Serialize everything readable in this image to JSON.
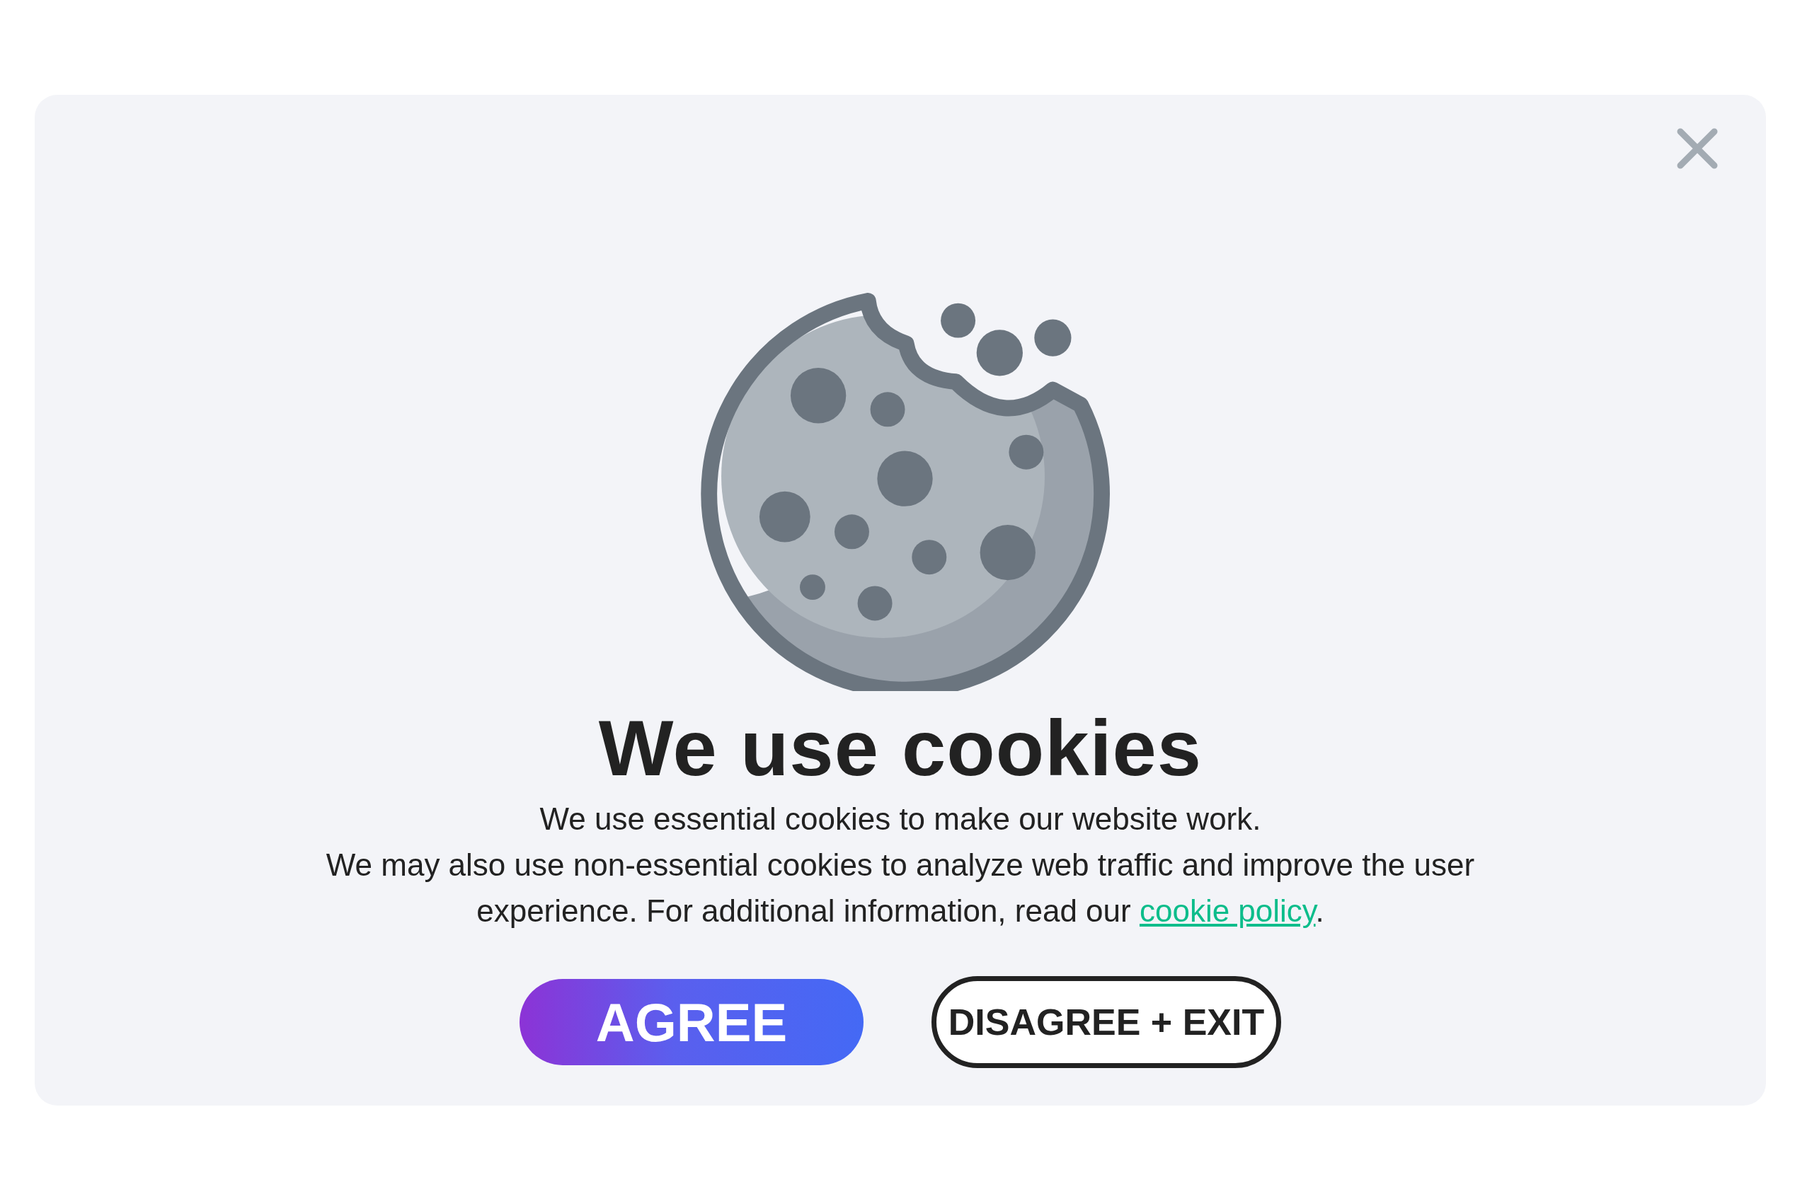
{
  "dialog": {
    "title": "We use cookies",
    "intro": "We use essential cookies to make our website work.",
    "details": "We may also use non-essential cookies to analyze web traffic and improve the user experience. For additional information, read our",
    "link": "cookie policy",
    "after_link": ".",
    "buttons": [
      {
        "label": "AGREE",
        "kind": "primary"
      },
      {
        "label": "DISAGREE + EXIT",
        "kind": "secondary"
      }
    ]
  }
}
